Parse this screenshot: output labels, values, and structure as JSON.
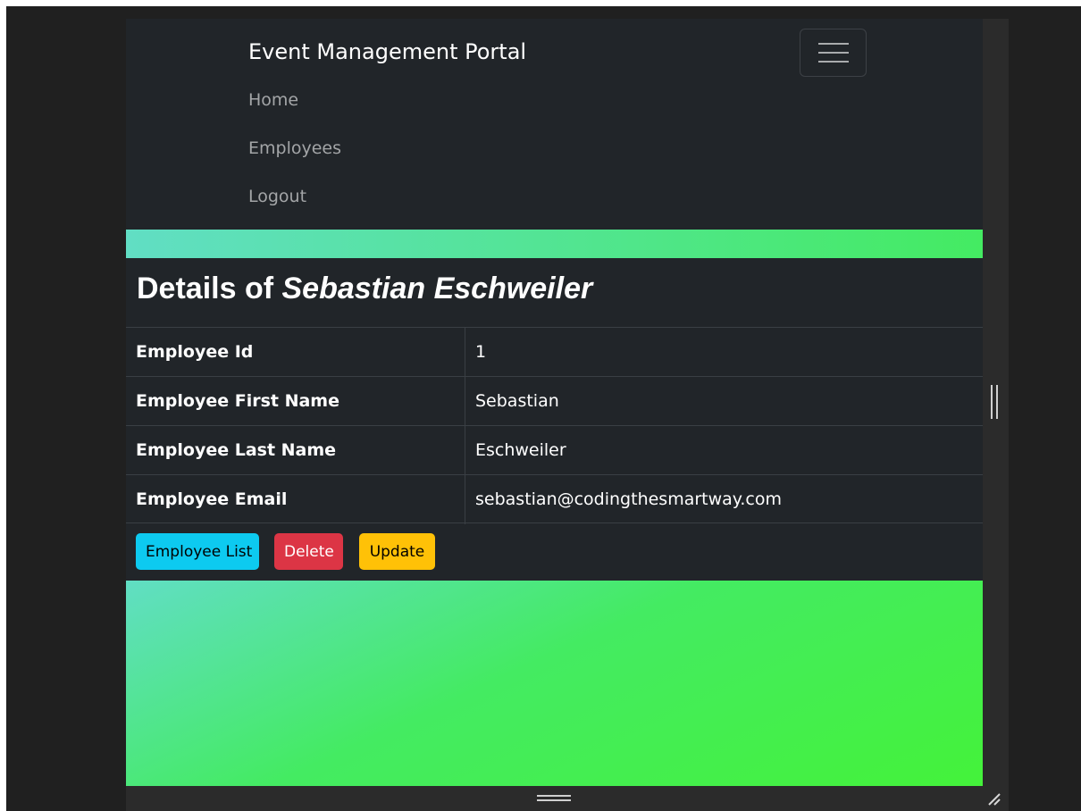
{
  "navbar": {
    "brand": "Event Management Portal",
    "links": [
      {
        "label": "Home"
      },
      {
        "label": "Employees"
      },
      {
        "label": "Logout"
      }
    ]
  },
  "details": {
    "title_prefix": "Details of",
    "title_name": "Sebastian Eschweiler",
    "rows": [
      {
        "label": "Employee Id",
        "value": "1"
      },
      {
        "label": "Employee First Name",
        "value": "Sebastian"
      },
      {
        "label": "Employee Last Name",
        "value": "Eschweiler"
      },
      {
        "label": "Employee Email",
        "value": "sebastian@codingthesmartway.com"
      }
    ]
  },
  "actions": {
    "list_label": "Employee List",
    "delete_label": "Delete",
    "update_label": "Update"
  },
  "colors": {
    "page_bg": "#212529",
    "info": "#0dcaf0",
    "danger": "#dc3545",
    "warning": "#ffc107",
    "gradient_start": "#61dec4",
    "gradient_end": "#44f23a"
  },
  "icons": {
    "toggler": "hamburger-menu-icon",
    "resize": "resize-handle-icon"
  }
}
